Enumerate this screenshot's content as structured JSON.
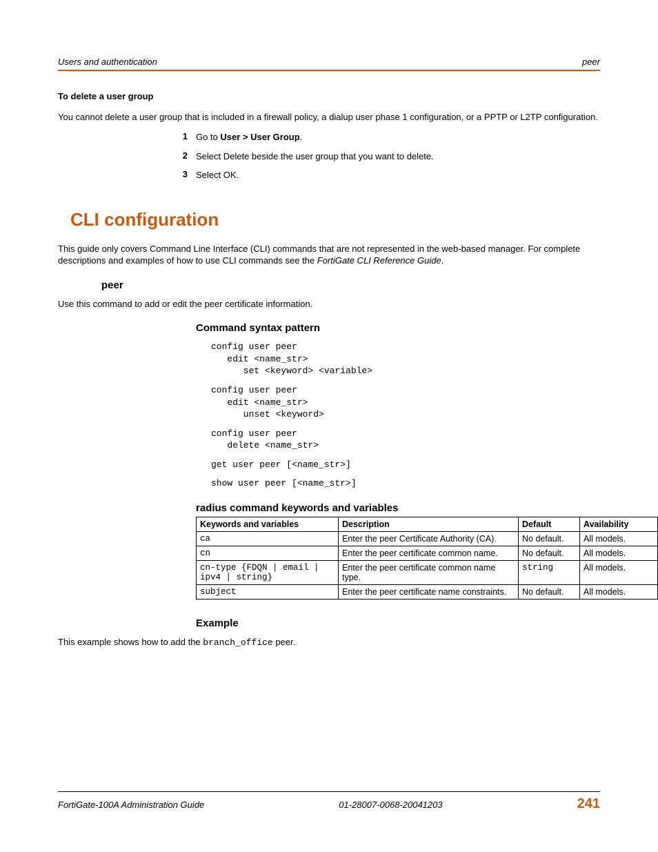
{
  "header": {
    "left": "Users and authentication",
    "right": "peer"
  },
  "delete_group": {
    "title": "To delete a user group",
    "intro": "You cannot delete a user group that is included in a firewall policy, a dialup user phase 1 configuration, or a PPTP or L2TP configuration.",
    "steps": [
      {
        "num": "1",
        "text_pre": "Go to ",
        "bold": "User > User Group",
        "text_post": "."
      },
      {
        "num": "2",
        "text_pre": "Select Delete beside the user group that you want to delete.",
        "bold": "",
        "text_post": ""
      },
      {
        "num": "3",
        "text_pre": "Select OK.",
        "bold": "",
        "text_post": ""
      }
    ]
  },
  "cli": {
    "heading": "CLI configuration",
    "intro_pre": "This guide only covers Command Line Interface (CLI) commands that are not represented in the web-based manager. For complete descriptions and examples of how to use CLI commands see the ",
    "intro_italic": "FortiGate CLI Reference Guide",
    "intro_post": "."
  },
  "peer": {
    "heading": "peer",
    "intro": "Use this command to add or edit the peer certificate information."
  },
  "syntax": {
    "heading": "Command syntax pattern",
    "block1": "config user peer\n   edit <name_str>\n      set <keyword> <variable>",
    "block2": "config user peer\n   edit <name_str>\n      unset <keyword>",
    "block3": "config user peer\n   delete <name_str>",
    "block4": "get user peer [<name_str>]",
    "block5": "show user peer [<name_str>]"
  },
  "table": {
    "caption": "radius command keywords and variables",
    "headers": [
      "Keywords and variables",
      "Description",
      "Default",
      "Availability"
    ],
    "rows": [
      {
        "kw": "ca",
        "desc": "Enter the peer Certificate Authority (CA).",
        "def": "No default.",
        "avail": "All models."
      },
      {
        "kw": "cn",
        "desc": "Enter the peer certificate common name.",
        "def": "No default.",
        "avail": "All models."
      },
      {
        "kw": "cn-type {FDQN | email | ipv4 | string}",
        "desc": "Enter the peer certificate common name type.",
        "def": "string",
        "avail": "All models.",
        "def_mono": true
      },
      {
        "kw": "subject",
        "desc": "Enter the peer certificate name constraints.",
        "def": "No default.",
        "avail": "All models."
      }
    ]
  },
  "example": {
    "heading": "Example",
    "text_pre": "This example shows how to add the ",
    "code": "branch_office",
    "text_post": " peer."
  },
  "footer": {
    "left": "FortiGate-100A Administration Guide",
    "center": "01-28007-0068-20041203",
    "page": "241"
  }
}
